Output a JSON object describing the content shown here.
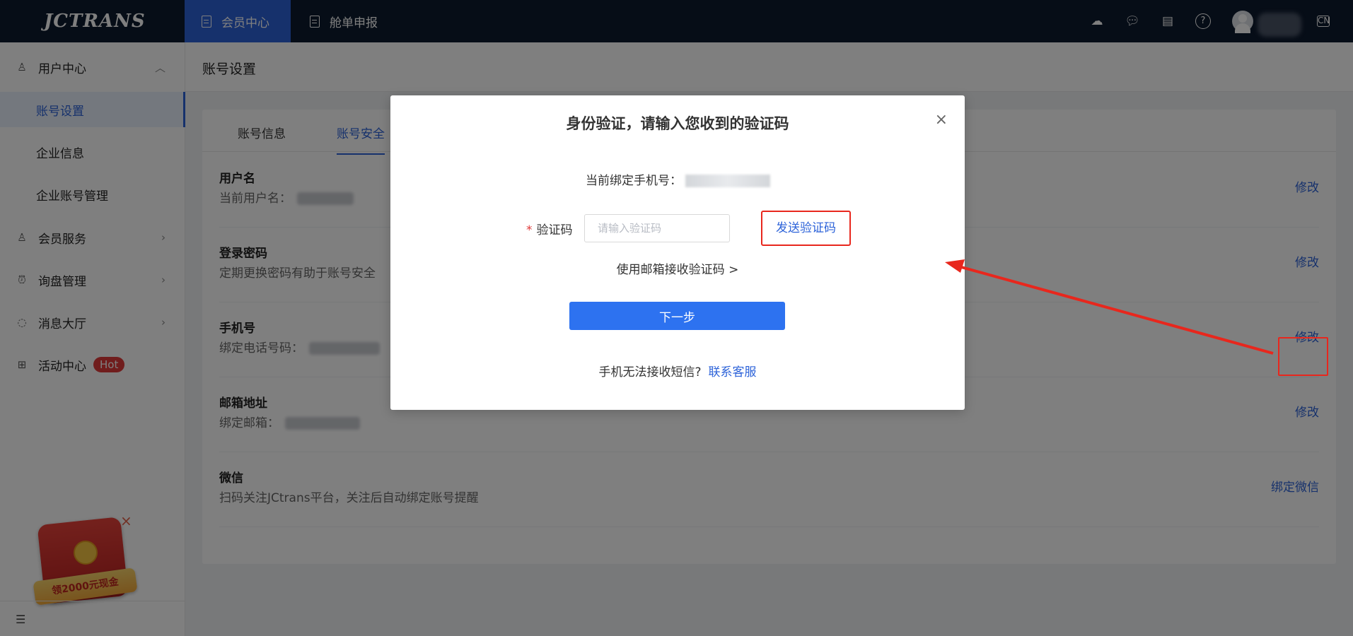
{
  "app": {
    "logo_text": "JCTRANS"
  },
  "topnav": {
    "tabs": [
      {
        "label": "会员中心",
        "icon": "document-icon",
        "active": true
      },
      {
        "label": "舱单申报",
        "icon": "document-icon",
        "active": false
      }
    ],
    "right_icons": [
      "cloud-service-icon",
      "chat-icon",
      "clipboard-icon",
      "help-icon",
      "language-icon"
    ],
    "accent_color": "#2d63d9",
    "bar_color": "#0d1a2e"
  },
  "sidebar": {
    "groups": [
      {
        "label": "用户中心",
        "icon": "user-icon",
        "expanded": true,
        "items": [
          {
            "label": "账号设置",
            "active": true
          },
          {
            "label": "企业信息",
            "active": false
          },
          {
            "label": "企业账号管理",
            "active": false
          }
        ]
      },
      {
        "label": "会员服务",
        "icon": "member-icon",
        "expanded": false
      },
      {
        "label": "询盘管理",
        "icon": "inquiry-icon",
        "expanded": false
      },
      {
        "label": "消息大厅",
        "icon": "message-icon",
        "expanded": false
      },
      {
        "label": "活动中心",
        "icon": "gift-icon",
        "badge": "Hot"
      }
    ],
    "promo_text": "领2000元现金",
    "close_glyph": "×"
  },
  "page": {
    "title": "账号设置",
    "tabs": [
      {
        "label": "账号信息",
        "active": false
      },
      {
        "label": "账号安全",
        "active": true
      }
    ],
    "rows": [
      {
        "title": "用户名",
        "desc": "当前用户名：",
        "action": "修改"
      },
      {
        "title": "登录密码",
        "desc": "定期更换密码有助于账号安全",
        "action": "修改"
      },
      {
        "title": "手机号",
        "desc": "绑定电话号码：",
        "action": "修改"
      },
      {
        "title": "邮箱地址",
        "desc": "绑定邮箱：",
        "action": "修改"
      },
      {
        "title": "微信",
        "desc": "扫码关注JCtrans平台，关注后自动绑定账号提醒",
        "action": "绑定微信"
      }
    ]
  },
  "modal": {
    "title": "身份验证，请输入您收到的验证码",
    "close_glyph": "×",
    "phone_label": "当前绑定手机号：",
    "required_mark": "*",
    "code_label": "验证码",
    "code_placeholder": "请输入验证码",
    "code_value": "",
    "send_button": "发送验证码",
    "email_link": "使用邮箱接收验证码 >",
    "next_button": "下一步",
    "help_text": "手机无法接收短信?",
    "help_link": "联系客服"
  },
  "annotation": {
    "highlight_color": "#e8271d"
  }
}
